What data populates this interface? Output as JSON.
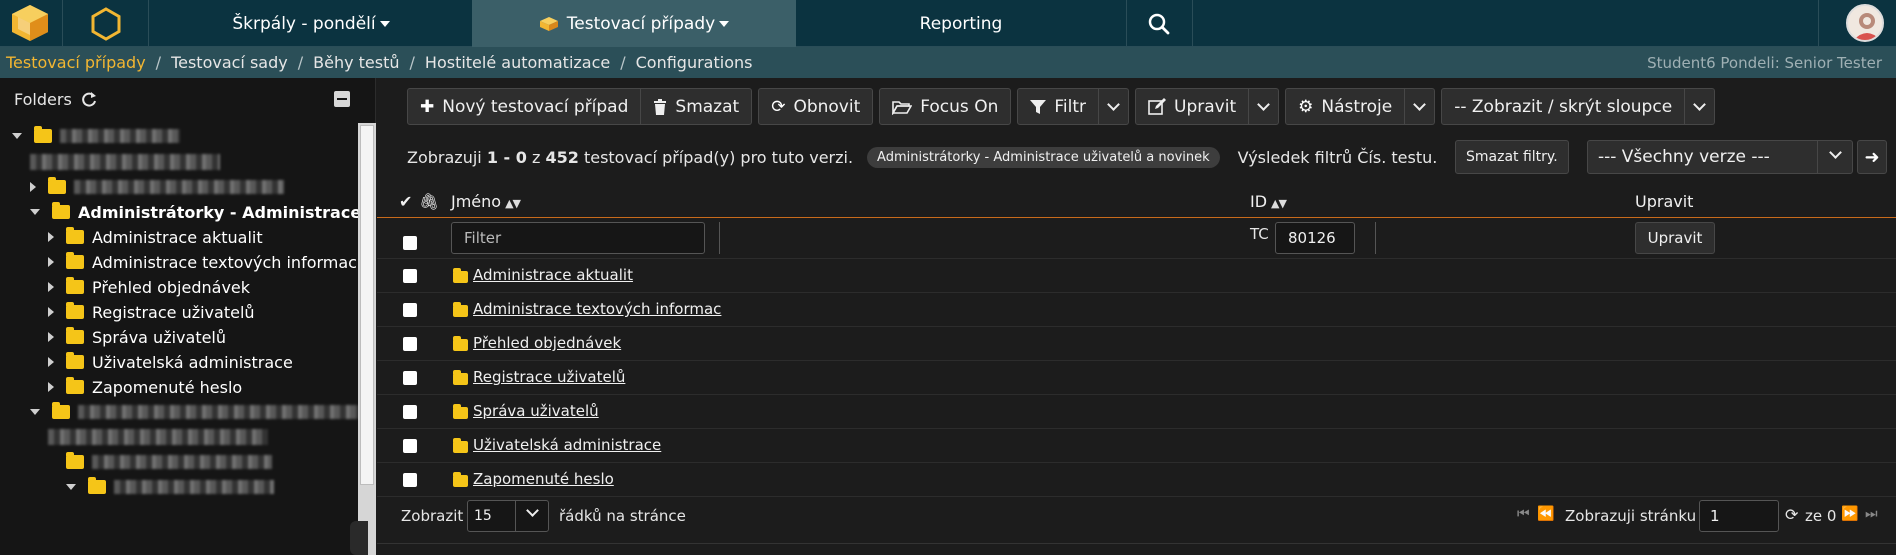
{
  "topnav": {
    "items": [
      {
        "label": "Škrpály - pondělí",
        "has_caret": true
      },
      {
        "label": "Testovací případy",
        "has_caret": true,
        "active": true
      },
      {
        "label": "Reporting",
        "has_caret": false
      }
    ],
    "search_icon": "search-icon",
    "avatar_icon": "user-avatar"
  },
  "breadcrumb": {
    "items": [
      "Testovací případy",
      "Testovací sady",
      "Běhy testů",
      "Hostitelé automatizace",
      "Configurations"
    ],
    "separator": "/",
    "user_info": "Student6 Pondeli: Senior Tester"
  },
  "sidebar": {
    "title": "Folders",
    "tree": [
      {
        "label": "Administrátorky - Administrace uživ",
        "bold": true,
        "open": true
      },
      {
        "label": "Administrace aktualit"
      },
      {
        "label": "Administrace textových informací"
      },
      {
        "label": "Přehled objednávek"
      },
      {
        "label": "Registrace uživatelů"
      },
      {
        "label": "Správa uživatelů"
      },
      {
        "label": "Uživatelská administrace"
      },
      {
        "label": "Zapomenuté heslo"
      }
    ]
  },
  "toolbar": {
    "new_label": "Nový testovací případ",
    "delete_label": "Smazat",
    "refresh_label": "Obnovit",
    "focus_label": "Focus On",
    "filter_label": "Filtr",
    "edit_label": "Upravit",
    "tools_label": "Nástroje",
    "columns_label": "-- Zobrazit / skrýt sloupce"
  },
  "info": {
    "prefix": "Zobrazuji",
    "range": "1 - 0",
    "of": "z",
    "total": "452",
    "suffix": "testovací případ(y) pro tuto verzi.",
    "filter_pill": "Administrátorky - Administrace uživatelů a novinek",
    "filter_result": "Výsledek filtrů Čís. testu.",
    "clear_filters": "Smazat filtry.",
    "version_select": "--- Všechny verze ---"
  },
  "table": {
    "headers": {
      "name": "Jméno",
      "id": "ID",
      "edit": "Upravit"
    },
    "filter_placeholder": "Filter",
    "tc_prefix": "TC",
    "tc_value": "80126",
    "edit_button": "Upravit",
    "rows": [
      "Administrace aktualit",
      "Administrace textových informac",
      "Přehled objednávek",
      "Registrace uživatelů",
      "Správa uživatelů",
      "Uživatelská administrace",
      "Zapomenuté heslo"
    ]
  },
  "footer": {
    "show_label": "Zobrazit",
    "per_page": "15",
    "rows_label": "řádků na stránce",
    "page_label": "Zobrazuji stránku",
    "page_value": "1",
    "of_label": "ze 0"
  },
  "colors": {
    "topbar": "#0b3340",
    "breadcrumb": "#2b4f58",
    "accent": "#f2b632",
    "folder": "#f5c518",
    "table_border": "#c86a1b"
  }
}
